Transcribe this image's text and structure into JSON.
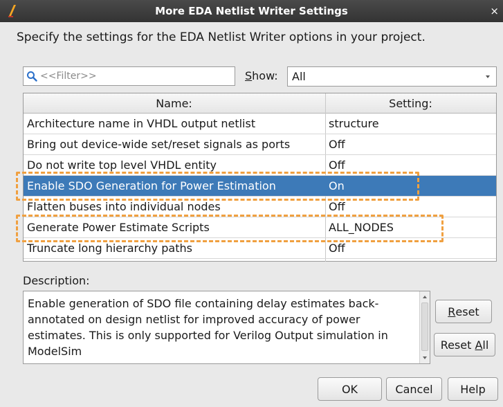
{
  "window": {
    "title": "More EDA Netlist Writer Settings",
    "close_glyph": "×"
  },
  "instructions": "Specify the settings for the EDA Netlist Writer options in your project.",
  "filter": {
    "placeholder": "<<Filter>>",
    "icon": "search-icon"
  },
  "show": {
    "label_mnemonic": "S",
    "label_rest": "how:",
    "selected": "All"
  },
  "table": {
    "columns": [
      "Name:",
      "Setting:"
    ],
    "rows": [
      {
        "name": "Architecture name in VHDL output netlist",
        "setting": "structure"
      },
      {
        "name": "Bring out device-wide set/reset signals as ports",
        "setting": "Off"
      },
      {
        "name": "Do not write top level VHDL entity",
        "setting": "Off"
      },
      {
        "name": "Enable SDO Generation for Power Estimation",
        "setting": "On"
      },
      {
        "name": "Flatten buses into individual nodes",
        "setting": "Off"
      },
      {
        "name": "Generate Power Estimate Scripts",
        "setting": "ALL_NODES"
      },
      {
        "name": "Truncate long hierarchy paths",
        "setting": "Off"
      }
    ],
    "selected_row": 3
  },
  "description": {
    "label": "Description:",
    "text": "Enable generation of SDO file containing delay estimates back-annotated on design netlist for improved accuracy of power estimates. This is only supported for Verilog Output simulation in ModelSim"
  },
  "buttons": {
    "reset_mnemonic": "R",
    "reset_rest": "eset",
    "reset_all_prefix": "Reset ",
    "reset_all_mnemonic": "A",
    "reset_all_rest": "ll",
    "ok": "OK",
    "cancel": "Cancel",
    "help": "Help"
  },
  "colors": {
    "selection": "#3d7ab8",
    "callout": "#f0a040",
    "titlebar": "#3a3a3a"
  }
}
